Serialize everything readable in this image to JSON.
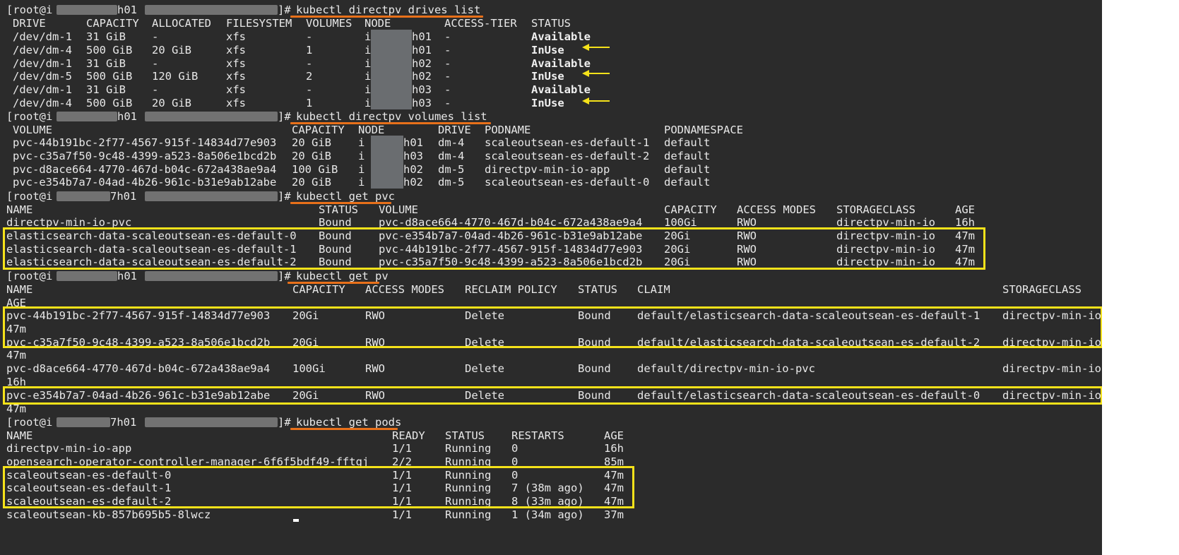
{
  "theme": {
    "bg": "#2b2b2b",
    "fg": "#e8e8e8",
    "underline": "#e8701a",
    "highlight": "#f5e21a"
  },
  "prompts": {
    "p1": {
      "user": "[root@i",
      "host": "h01",
      "close": "]#",
      "command": "kubectl directpv drives list"
    },
    "p2": {
      "user": "[root@i",
      "host": "h01",
      "close": "]#",
      "command": "kubectl directpv volumes list"
    },
    "p3": {
      "user": "[root@i",
      "host": "7h01",
      "close": "]#",
      "command": "kubectl get pvc"
    },
    "p4": {
      "user": "[root@i",
      "host": "h01",
      "close": "]#",
      "command": "kubectl get pv"
    },
    "p5": {
      "user": "[root@i",
      "host": "7h01",
      "close": "]#",
      "command": "kubectl get pods"
    }
  },
  "drives": {
    "headers": [
      "DRIVE",
      "CAPACITY",
      "ALLOCATED",
      "FILESYSTEM",
      "VOLUMES",
      "NODE",
      "ACCESS-TIER",
      "STATUS"
    ],
    "rows": [
      [
        "/dev/dm-1",
        "31 GiB",
        "-",
        "xfs",
        "-",
        "i",
        "h01",
        "-",
        "Available"
      ],
      [
        "/dev/dm-4",
        "500 GiB",
        "20 GiB",
        "xfs",
        "1",
        "i",
        "h01",
        "-",
        "InUse"
      ],
      [
        "/dev/dm-1",
        "31 GiB",
        "-",
        "xfs",
        "-",
        "i",
        "h02",
        "-",
        "Available"
      ],
      [
        "/dev/dm-5",
        "500 GiB",
        "120 GiB",
        "xfs",
        "2",
        "i",
        "h02",
        "-",
        "InUse"
      ],
      [
        "/dev/dm-1",
        "31 GiB",
        "-",
        "xfs",
        "-",
        "i",
        "h03",
        "-",
        "Available"
      ],
      [
        "/dev/dm-4",
        "500 GiB",
        "20 GiB",
        "xfs",
        "1",
        "i",
        "h03",
        "-",
        "InUse"
      ]
    ]
  },
  "volumes": {
    "headers": [
      "VOLUME",
      "CAPACITY",
      "NODE",
      "DRIVE",
      "PODNAME",
      "PODNAMESPACE"
    ],
    "rows": [
      [
        "pvc-44b191bc-2f77-4567-915f-14834d77e903",
        "20 GiB",
        "i",
        "h01",
        "dm-4",
        "scaleoutsean-es-default-1",
        "default"
      ],
      [
        "pvc-c35a7f50-9c48-4399-a523-8a506e1bcd2b",
        "20 GiB",
        "i",
        "h03",
        "dm-4",
        "scaleoutsean-es-default-2",
        "default"
      ],
      [
        "pvc-d8ace664-4770-467d-b04c-672a438ae9a4",
        "100 GiB",
        "i",
        "h02",
        "dm-5",
        "directpv-min-io-app",
        "default"
      ],
      [
        "pvc-e354b7a7-04ad-4b26-961c-b31e9ab12abe",
        "20 GiB",
        "i",
        "h02",
        "dm-5",
        "scaleoutsean-es-default-0",
        "default"
      ]
    ]
  },
  "pvc": {
    "headers": [
      "NAME",
      "STATUS",
      "VOLUME",
      "CAPACITY",
      "ACCESS MODES",
      "STORAGECLASS",
      "AGE"
    ],
    "rows": [
      [
        "directpv-min-io-pvc",
        "Bound",
        "pvc-d8ace664-4770-467d-b04c-672a438ae9a4",
        "100Gi",
        "RWO",
        "directpv-min-io",
        "16h"
      ],
      [
        "elasticsearch-data-scaleoutsean-es-default-0",
        "Bound",
        "pvc-e354b7a7-04ad-4b26-961c-b31e9ab12abe",
        "20Gi",
        "RWO",
        "directpv-min-io",
        "47m"
      ],
      [
        "elasticsearch-data-scaleoutsean-es-default-1",
        "Bound",
        "pvc-44b191bc-2f77-4567-915f-14834d77e903",
        "20Gi",
        "RWO",
        "directpv-min-io",
        "47m"
      ],
      [
        "elasticsearch-data-scaleoutsean-es-default-2",
        "Bound",
        "pvc-c35a7f50-9c48-4399-a523-8a506e1bcd2b",
        "20Gi",
        "RWO",
        "directpv-min-io",
        "47m"
      ]
    ]
  },
  "pv": {
    "headers": [
      "NAME",
      "CAPACITY",
      "ACCESS MODES",
      "RECLAIM POLICY",
      "STATUS",
      "CLAIM",
      "STORAGECLASS"
    ],
    "age_header": "AGE",
    "rows": [
      [
        "pvc-44b191bc-2f77-4567-915f-14834d77e903",
        "20Gi",
        "RWO",
        "Delete",
        "Bound",
        "default/elasticsearch-data-scaleoutsean-es-default-1",
        "directpv-min-io",
        "47m"
      ],
      [
        "pvc-c35a7f50-9c48-4399-a523-8a506e1bcd2b",
        "20Gi",
        "RWO",
        "Delete",
        "Bound",
        "default/elasticsearch-data-scaleoutsean-es-default-2",
        "directpv-min-io",
        "47m"
      ],
      [
        "pvc-d8ace664-4770-467d-b04c-672a438ae9a4",
        "100Gi",
        "RWO",
        "Delete",
        "Bound",
        "default/directpv-min-io-pvc",
        "directpv-min-io",
        "16h"
      ],
      [
        "pvc-e354b7a7-04ad-4b26-961c-b31e9ab12abe",
        "20Gi",
        "RWO",
        "Delete",
        "Bound",
        "default/elasticsearch-data-scaleoutsean-es-default-0",
        "directpv-min-io",
        "47m"
      ]
    ]
  },
  "pods": {
    "headers": [
      "NAME",
      "READY",
      "STATUS",
      "RESTARTS",
      "AGE"
    ],
    "rows": [
      [
        "directpv-min-io-app",
        "1/1",
        "Running",
        "0",
        "16h"
      ],
      [
        "opensearch-operator-controller-manager-6f6f5bdf49-fftgj",
        "2/2",
        "Running",
        "0",
        "85m"
      ],
      [
        "scaleoutsean-es-default-0",
        "1/1",
        "Running",
        "0",
        "47m"
      ],
      [
        "scaleoutsean-es-default-1",
        "1/1",
        "Running",
        "7 (38m ago)",
        "47m"
      ],
      [
        "scaleoutsean-es-default-2",
        "1/1",
        "Running",
        "8 (33m ago)",
        "47m"
      ],
      [
        "scaleoutsean-kb-857b695b5-8lwcz",
        "1/1",
        "Running",
        "1 (34m ago)",
        "37m"
      ]
    ]
  }
}
